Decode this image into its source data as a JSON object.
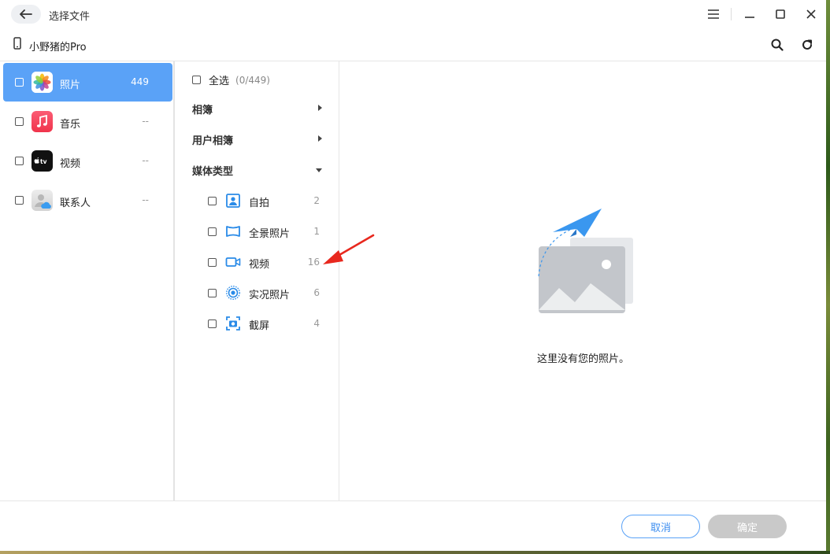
{
  "titlebar": {
    "title": "选择文件"
  },
  "device": {
    "name": "小野猪的Pro"
  },
  "categories": [
    {
      "label": "照片",
      "count": "449",
      "icon": "photos-app-icon"
    },
    {
      "label": "音乐",
      "count": "--",
      "icon": "music-app-icon"
    },
    {
      "label": "视频",
      "count": "--",
      "icon": "apple-tv-app-icon"
    },
    {
      "label": "联系人",
      "count": "--",
      "icon": "contacts-app-icon"
    }
  ],
  "middle": {
    "select_all_label": "全选",
    "select_all_count": "(0/449)",
    "groups": [
      {
        "label": "相簿",
        "state": "collapsed"
      },
      {
        "label": "用户相簿",
        "state": "collapsed"
      },
      {
        "label": "媒体类型",
        "state": "expanded"
      }
    ],
    "media_types": [
      {
        "label": "自拍",
        "count": "2",
        "icon": "selfie-icon"
      },
      {
        "label": "全景照片",
        "count": "1",
        "icon": "panorama-icon"
      },
      {
        "label": "视频",
        "count": "16",
        "icon": "video-camera-icon"
      },
      {
        "label": "实况照片",
        "count": "6",
        "icon": "live-photo-icon"
      },
      {
        "label": "截屏",
        "count": "4",
        "icon": "screenshot-icon"
      }
    ]
  },
  "right": {
    "empty_message": "这里没有您的照片。"
  },
  "footer": {
    "cancel_label": "取消",
    "ok_label": "确定"
  },
  "colors": {
    "accent": "#5aa2f7",
    "annotation_arrow": "#e8281e"
  }
}
